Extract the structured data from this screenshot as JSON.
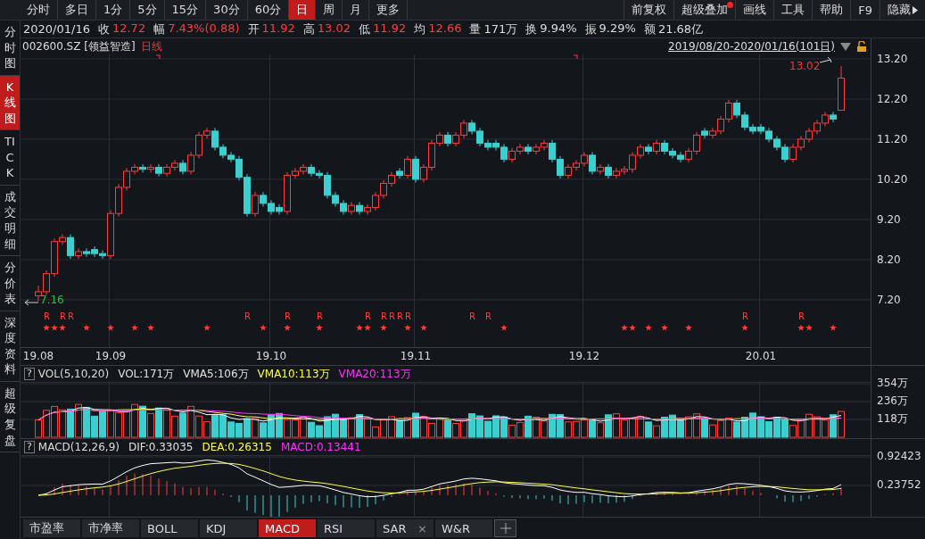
{
  "toolbar": {
    "periods": [
      {
        "label": "分时",
        "selected": false
      },
      {
        "label": "多日",
        "selected": false
      },
      {
        "label": "1分",
        "selected": false
      },
      {
        "label": "5分",
        "selected": false
      },
      {
        "label": "15分",
        "selected": false
      },
      {
        "label": "30分",
        "selected": false
      },
      {
        "label": "60分",
        "selected": false
      },
      {
        "label": "日",
        "selected": true
      },
      {
        "label": "周",
        "selected": false
      },
      {
        "label": "月",
        "selected": false
      },
      {
        "label": "更多",
        "selected": false
      }
    ],
    "tools": [
      {
        "label": "前复权",
        "badge": false,
        "kind": "plain"
      },
      {
        "label": "超级叠加",
        "badge": true,
        "kind": "plain"
      },
      {
        "label": "画线",
        "badge": false,
        "kind": "plain"
      },
      {
        "label": "工具",
        "badge": false,
        "kind": "plain"
      },
      {
        "label": "帮助",
        "badge": false,
        "kind": "plain"
      },
      {
        "label": "F9",
        "badge": false,
        "kind": "plain"
      },
      {
        "label": "隐藏",
        "badge": false,
        "kind": "expand"
      }
    ]
  },
  "sidebar": [
    {
      "label": "分时图",
      "selected": false
    },
    {
      "label": "K线图",
      "selected": true
    },
    {
      "label": "TICK",
      "selected": false
    },
    {
      "label": "成交明细",
      "selected": false
    },
    {
      "label": "分价表",
      "selected": false
    },
    {
      "label": "深度资料",
      "selected": false
    },
    {
      "label": "超级复盘",
      "selected": false
    }
  ],
  "quote": {
    "date": "2020/01/16",
    "fields": [
      {
        "label": "收",
        "value": "12.72",
        "kind": "up"
      },
      {
        "label": "幅",
        "value": "7.43%(0.88)",
        "kind": "up"
      },
      {
        "label": "开",
        "value": "11.92",
        "kind": "up"
      },
      {
        "label": "高",
        "value": "13.02",
        "kind": "up"
      },
      {
        "label": "低",
        "value": "11.92",
        "kind": "up"
      },
      {
        "label": "均",
        "value": "12.66",
        "kind": "up"
      },
      {
        "label": "量",
        "value": "171万",
        "kind": "plain"
      },
      {
        "label": "换",
        "value": "9.94%",
        "kind": "plain"
      },
      {
        "label": "振",
        "value": "9.29%",
        "kind": "plain"
      },
      {
        "label": "额",
        "value": "21.68亿",
        "kind": "plain"
      }
    ]
  },
  "chart": {
    "symbol": "002600.SZ [领益智造]",
    "period": "日线",
    "range": "2019/08/20-2020/01/16(101日)",
    "locked": false,
    "high_label": "13.02",
    "low_label": "7.16",
    "signal_labels": [
      "R",
      "R",
      "R",
      "R",
      "R",
      "R",
      "R",
      "R",
      "R",
      "R",
      "R",
      "R",
      "R",
      "R",
      "R"
    ],
    "chart_data": {
      "type": "candlestick",
      "grid": true,
      "ylim": [
        6.02,
        13.31
      ],
      "yticks": [
        {
          "value": 13.2,
          "label": "13.20"
        },
        {
          "value": 12.2,
          "label": "12.20"
        },
        {
          "value": 11.2,
          "label": "11.20"
        },
        {
          "value": 10.2,
          "label": "10.20"
        },
        {
          "value": 9.2,
          "label": "9.20"
        },
        {
          "value": 8.2,
          "label": "8.20"
        },
        {
          "value": 7.2,
          "label": "7.20"
        }
      ],
      "categories": [
        "19.08",
        null,
        null,
        null,
        null,
        null,
        null,
        null,
        null,
        "19.09",
        null,
        null,
        null,
        null,
        null,
        null,
        null,
        null,
        null,
        null,
        null,
        null,
        null,
        null,
        null,
        null,
        null,
        null,
        null,
        "19.10",
        null,
        null,
        null,
        null,
        null,
        null,
        null,
        null,
        null,
        null,
        null,
        null,
        null,
        null,
        null,
        null,
        null,
        "19.11",
        null,
        null,
        null,
        null,
        null,
        null,
        null,
        null,
        null,
        null,
        null,
        null,
        null,
        null,
        null,
        null,
        null,
        null,
        null,
        null,
        "19.12",
        null,
        null,
        null,
        null,
        null,
        null,
        null,
        null,
        null,
        null,
        null,
        null,
        null,
        null,
        null,
        null,
        null,
        null,
        null,
        null,
        null,
        "20.01",
        null,
        null,
        null,
        null,
        null,
        null,
        null,
        null,
        null,
        null
      ],
      "ohlc": [
        [
          7.3,
          7.55,
          7.16,
          7.4
        ],
        [
          7.4,
          7.93,
          7.32,
          7.85
        ],
        [
          7.85,
          8.73,
          7.77,
          8.65
        ],
        [
          8.65,
          8.83,
          8.57,
          8.75
        ],
        [
          8.75,
          8.83,
          8.22,
          8.3
        ],
        [
          8.3,
          8.48,
          8.22,
          8.4
        ],
        [
          8.4,
          8.48,
          8.27,
          8.35
        ],
        [
          8.45,
          8.53,
          8.27,
          8.35
        ],
        [
          8.35,
          8.43,
          8.22,
          8.3
        ],
        [
          8.3,
          9.43,
          8.22,
          9.35
        ],
        [
          9.35,
          10.08,
          9.27,
          10.0
        ],
        [
          10.0,
          10.48,
          9.92,
          10.4
        ],
        [
          10.4,
          10.58,
          10.32,
          10.5
        ],
        [
          10.5,
          10.58,
          10.37,
          10.45
        ],
        [
          10.45,
          10.58,
          10.37,
          10.5
        ],
        [
          10.5,
          10.58,
          10.27,
          10.35
        ],
        [
          10.35,
          10.58,
          10.27,
          10.5
        ],
        [
          10.5,
          10.68,
          10.42,
          10.6
        ],
        [
          10.6,
          10.68,
          10.32,
          10.4
        ],
        [
          10.4,
          10.88,
          10.32,
          10.8
        ],
        [
          10.8,
          11.38,
          10.72,
          11.3
        ],
        [
          11.3,
          11.48,
          11.22,
          11.4
        ],
        [
          11.4,
          11.48,
          10.92,
          11.0
        ],
        [
          11.0,
          11.08,
          10.72,
          10.8
        ],
        [
          10.8,
          10.88,
          10.62,
          10.7
        ],
        [
          10.7,
          10.78,
          10.17,
          10.25
        ],
        [
          10.25,
          10.33,
          9.27,
          9.35
        ],
        [
          9.35,
          9.88,
          9.27,
          9.8
        ],
        [
          9.8,
          9.88,
          9.52,
          9.6
        ],
        [
          9.6,
          9.68,
          9.32,
          9.4
        ],
        [
          9.5,
          9.58,
          9.32,
          9.4
        ],
        [
          9.4,
          10.38,
          9.32,
          10.3
        ],
        [
          10.3,
          10.48,
          10.22,
          10.4
        ],
        [
          10.4,
          10.58,
          10.32,
          10.5
        ],
        [
          10.5,
          10.58,
          10.27,
          10.35
        ],
        [
          10.35,
          10.43,
          10.22,
          10.3
        ],
        [
          10.3,
          10.38,
          9.72,
          9.8
        ],
        [
          9.8,
          9.88,
          9.52,
          9.6
        ],
        [
          9.6,
          9.68,
          9.32,
          9.4
        ],
        [
          9.4,
          9.63,
          9.32,
          9.55
        ],
        [
          9.55,
          9.63,
          9.32,
          9.4
        ],
        [
          9.4,
          9.58,
          9.32,
          9.5
        ],
        [
          9.5,
          9.88,
          9.42,
          9.8
        ],
        [
          9.8,
          10.18,
          9.72,
          10.1
        ],
        [
          10.1,
          10.38,
          10.02,
          10.3
        ],
        [
          10.4,
          10.48,
          10.22,
          10.3
        ],
        [
          10.3,
          10.78,
          10.22,
          10.7
        ],
        [
          10.7,
          10.78,
          10.12,
          10.2
        ],
        [
          10.2,
          10.58,
          10.12,
          10.5
        ],
        [
          10.5,
          11.18,
          10.42,
          11.1
        ],
        [
          11.1,
          11.38,
          11.02,
          11.3
        ],
        [
          11.3,
          11.38,
          11.02,
          11.1
        ],
        [
          11.1,
          11.38,
          11.02,
          11.3
        ],
        [
          11.3,
          11.68,
          11.22,
          11.6
        ],
        [
          11.6,
          11.68,
          11.32,
          11.4
        ],
        [
          11.4,
          11.48,
          11.02,
          11.1
        ],
        [
          11.1,
          11.18,
          10.92,
          11.0
        ],
        [
          11.1,
          11.18,
          10.92,
          11.0
        ],
        [
          11.0,
          11.08,
          10.62,
          10.7
        ],
        [
          10.7,
          10.98,
          10.62,
          10.9
        ],
        [
          10.9,
          11.08,
          10.82,
          11.0
        ],
        [
          11.0,
          11.08,
          10.82,
          10.9
        ],
        [
          10.9,
          11.08,
          10.82,
          11.0
        ],
        [
          11.0,
          11.18,
          10.92,
          11.1
        ],
        [
          11.1,
          11.18,
          10.62,
          10.7
        ],
        [
          10.7,
          10.78,
          10.22,
          10.3
        ],
        [
          10.3,
          10.58,
          10.22,
          10.5
        ],
        [
          10.5,
          10.68,
          10.42,
          10.6
        ],
        [
          10.6,
          10.88,
          10.52,
          10.8
        ],
        [
          10.8,
          10.88,
          10.32,
          10.4
        ],
        [
          10.4,
          10.58,
          10.32,
          10.5
        ],
        [
          10.5,
          10.58,
          10.22,
          10.3
        ],
        [
          10.3,
          10.48,
          10.22,
          10.4
        ],
        [
          10.4,
          10.53,
          10.32,
          10.45
        ],
        [
          10.45,
          10.88,
          10.37,
          10.8
        ],
        [
          10.8,
          11.08,
          10.72,
          11.0
        ],
        [
          11.0,
          11.08,
          10.82,
          10.9
        ],
        [
          10.9,
          11.18,
          10.82,
          11.1
        ],
        [
          11.1,
          11.18,
          10.82,
          10.9
        ],
        [
          10.9,
          10.98,
          10.72,
          10.8
        ],
        [
          10.8,
          10.88,
          10.62,
          10.7
        ],
        [
          10.7,
          10.98,
          10.62,
          10.9
        ],
        [
          10.9,
          11.38,
          10.82,
          11.3
        ],
        [
          11.4,
          11.48,
          11.22,
          11.3
        ],
        [
          11.3,
          11.48,
          11.22,
          11.4
        ],
        [
          11.4,
          11.78,
          11.32,
          11.7
        ],
        [
          11.7,
          12.18,
          11.62,
          12.1
        ],
        [
          12.1,
          12.18,
          11.72,
          11.8
        ],
        [
          11.8,
          11.88,
          11.42,
          11.5
        ],
        [
          11.5,
          11.58,
          11.32,
          11.4
        ],
        [
          11.5,
          11.58,
          11.32,
          11.4
        ],
        [
          11.4,
          11.48,
          11.12,
          11.2
        ],
        [
          11.2,
          11.28,
          10.92,
          11.0
        ],
        [
          11.0,
          11.08,
          10.62,
          10.7
        ],
        [
          10.7,
          11.08,
          10.62,
          11.0
        ],
        [
          11.0,
          11.28,
          10.92,
          11.2
        ],
        [
          11.2,
          11.48,
          11.12,
          11.4
        ],
        [
          11.4,
          11.68,
          11.32,
          11.6
        ],
        [
          11.6,
          11.88,
          11.52,
          11.8
        ],
        [
          11.8,
          11.88,
          11.62,
          11.7
        ],
        [
          11.92,
          13.02,
          11.92,
          12.72
        ]
      ]
    }
  },
  "volume": {
    "help": "?",
    "title": "VOL(5,10,20)",
    "values": [
      {
        "label": "VOL:171万",
        "color": "#e0e0e0"
      },
      {
        "label": "VMA5:106万",
        "color": "#e0e0e0"
      },
      {
        "label": "VMA10:113万",
        "color": "#ffff40"
      },
      {
        "label": "VMA20:113万",
        "color": "#ff30ff"
      }
    ],
    "ticks": [
      "354万",
      "236万",
      "118万"
    ]
  },
  "macd": {
    "help": "?",
    "title": "MACD(12,26,9)",
    "values": [
      {
        "label": "DIF:0.33035",
        "color": "#e0e0e0"
      },
      {
        "label": "DEA:0.26315",
        "color": "#ffff40"
      },
      {
        "label": "MACD:0.13441",
        "color": "#ff30ff"
      }
    ],
    "ticks": [
      "0.92423",
      "0.23752"
    ]
  },
  "bottom_tabs": [
    {
      "label": "市盈率",
      "selected": false
    },
    {
      "label": "市净率",
      "selected": false
    },
    {
      "label": "BOLL",
      "selected": false
    },
    {
      "label": "KDJ",
      "selected": false
    },
    {
      "label": "MACD",
      "selected": true
    },
    {
      "label": "RSI",
      "selected": false
    },
    {
      "label": "SAR",
      "selected": false,
      "close_mark": "×"
    },
    {
      "label": "W&R",
      "selected": false
    }
  ]
}
